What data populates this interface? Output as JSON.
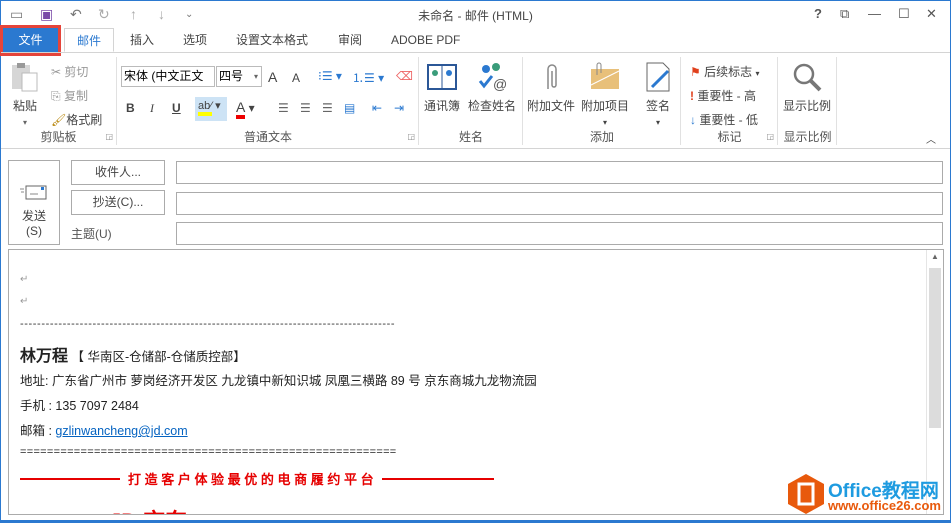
{
  "window": {
    "title": "未命名 - 邮件 (HTML)",
    "help": "?",
    "restore": "⧉",
    "minimize": "—",
    "maximize": "☐",
    "close": "✕"
  },
  "qat": {
    "new": "▭",
    "save": "💾",
    "undo": "↶",
    "redo": "↻",
    "up": "↑",
    "down": "↓",
    "more": "⌄"
  },
  "tabs": [
    {
      "label": "文件"
    },
    {
      "label": "邮件"
    },
    {
      "label": "插入"
    },
    {
      "label": "选项"
    },
    {
      "label": "设置文本格式"
    },
    {
      "label": "审阅"
    },
    {
      "label": "ADOBE PDF"
    }
  ],
  "ribbon": {
    "clipboard": {
      "label": "剪贴板",
      "paste": "粘贴",
      "cut": "剪切",
      "copy": "复制",
      "format_painter": "格式刷"
    },
    "basic_text": {
      "label": "普通文本",
      "font": "宋体 (中文正文",
      "size": "四号",
      "bold": "B",
      "italic": "I",
      "underline": "U",
      "grow": "A",
      "shrink": "A",
      "font_color": "A"
    },
    "names": {
      "label": "姓名",
      "address_book": "通讯簿",
      "check_names": "检查姓名"
    },
    "include": {
      "label": "添加",
      "attach_file": "附加文件",
      "attach_item": "附加项目",
      "signature": "签名"
    },
    "tags": {
      "label": "标记",
      "follow_up": "后续标志",
      "high": "重要性 - 高",
      "low": "重要性 - 低"
    },
    "zoom": {
      "label": "显示比例",
      "zoom": "显示比例"
    }
  },
  "compose": {
    "send": "发送",
    "send_key": "(S)",
    "to": "收件人...",
    "cc": "抄送(C)...",
    "subject": "主题(U)",
    "to_value": "",
    "cc_value": "",
    "subject_value": ""
  },
  "body": {
    "dashes": "----------------------------------------------------------------------------------------",
    "name": "林万程",
    "dept": "【 华南区-仓储部-仓储质控部】",
    "address": "地址: 广东省广州市 萝岗经济开发区 九龙镇中新知识城 凤凰三横路 89 号 京东商城九龙物流园",
    "phone": "手机 : 135 7097 2484",
    "email_label": "邮箱 : ",
    "email": "gzlinwancheng@jd.com",
    "equals": "========================================================",
    "slogan": "打 造 客 户 体 验 最 优 的 电 商 履 约 平 台",
    "logo_text": "JD 京东"
  },
  "watermark": {
    "brand": "Office教程网",
    "url": "www.office26.com"
  },
  "colors": {
    "accent": "#2b79d0",
    "slogan": "#e60000",
    "link": "#0563c1",
    "highlight": "#ffff00",
    "watermark": "#e8590c"
  }
}
